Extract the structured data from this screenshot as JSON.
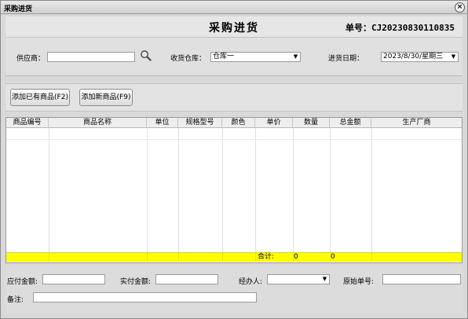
{
  "window": {
    "title": "采购进货",
    "close_glyph": "×"
  },
  "header": {
    "title": "采购进货",
    "order_label": "单号：",
    "order_no": "CJ20230830110835"
  },
  "filters": {
    "supplier_label": "供应商：",
    "supplier_value": "",
    "warehouse_label": "收货仓库：",
    "warehouse_value": "仓库一",
    "date_label": "进货日期：",
    "date_value": "2023/8/30/星期三"
  },
  "toolbar": {
    "add_existing": "添加已有商品(F2)",
    "add_new": "添加新商品(F9)"
  },
  "table": {
    "columns": [
      "商品编号",
      "商品名称",
      "单位",
      "规格型号",
      "颜色",
      "单价",
      "数量",
      "总金额",
      "生产厂商"
    ],
    "rows": [],
    "total_label": "合计:",
    "total_qty": "0",
    "total_amount": "0"
  },
  "footer": {
    "payable_label": "应付金额:",
    "payable_value": "",
    "paid_label": "实付金额:",
    "paid_value": "",
    "handler_label": "经办人:",
    "handler_value": "",
    "original_no_label": "原始单号:",
    "original_no_value": "",
    "remark_label": "备注:",
    "remark_value": ""
  },
  "icons": {
    "search": "search-icon",
    "dropdown": "chevron-down-icon",
    "close": "close-icon"
  }
}
